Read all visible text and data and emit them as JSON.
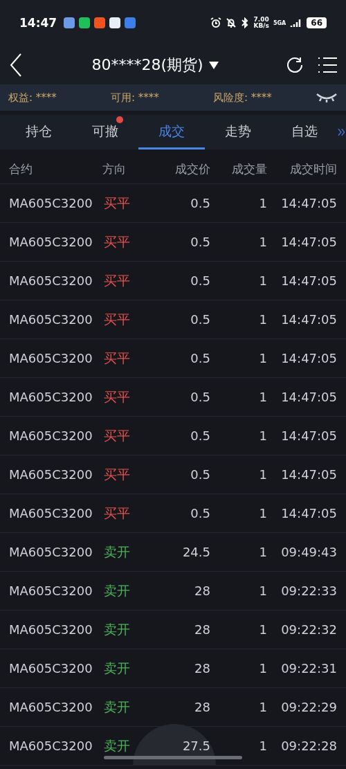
{
  "status_bar": {
    "time": "14:47",
    "speed_value": "7.00",
    "speed_unit": "KB/s",
    "network": "5GA",
    "battery": "66"
  },
  "header": {
    "account": "80****28(期货)"
  },
  "summary": [
    {
      "label": "权益:",
      "value": "****"
    },
    {
      "label": "可用:",
      "value": "****"
    },
    {
      "label": "风险度:",
      "value": "****"
    }
  ],
  "tabs": [
    {
      "label": "持仓",
      "selected": false,
      "badge": false
    },
    {
      "label": "可撤",
      "selected": false,
      "badge": true
    },
    {
      "label": "成交",
      "selected": true,
      "badge": false
    },
    {
      "label": "走势",
      "selected": false,
      "badge": false
    },
    {
      "label": "自选",
      "selected": false,
      "badge": false
    }
  ],
  "table": {
    "columns": [
      "合约",
      "方向",
      "成交价",
      "成交量",
      "成交时间"
    ],
    "rows": [
      {
        "contract": "MA605C3200",
        "direction": "买平",
        "color": "#e5524f",
        "price": "0.5",
        "qty": "1",
        "time": "14:47:05"
      },
      {
        "contract": "MA605C3200",
        "direction": "买平",
        "color": "#e5524f",
        "price": "0.5",
        "qty": "1",
        "time": "14:47:05"
      },
      {
        "contract": "MA605C3200",
        "direction": "买平",
        "color": "#e5524f",
        "price": "0.5",
        "qty": "1",
        "time": "14:47:05"
      },
      {
        "contract": "MA605C3200",
        "direction": "买平",
        "color": "#e5524f",
        "price": "0.5",
        "qty": "1",
        "time": "14:47:05"
      },
      {
        "contract": "MA605C3200",
        "direction": "买平",
        "color": "#e5524f",
        "price": "0.5",
        "qty": "1",
        "time": "14:47:05"
      },
      {
        "contract": "MA605C3200",
        "direction": "买平",
        "color": "#e5524f",
        "price": "0.5",
        "qty": "1",
        "time": "14:47:05"
      },
      {
        "contract": "MA605C3200",
        "direction": "买平",
        "color": "#e5524f",
        "price": "0.5",
        "qty": "1",
        "time": "14:47:05"
      },
      {
        "contract": "MA605C3200",
        "direction": "买平",
        "color": "#e5524f",
        "price": "0.5",
        "qty": "1",
        "time": "14:47:05"
      },
      {
        "contract": "MA605C3200",
        "direction": "买平",
        "color": "#e5524f",
        "price": "0.5",
        "qty": "1",
        "time": "14:47:05"
      },
      {
        "contract": "MA605C3200",
        "direction": "卖开",
        "color": "#4caf5a",
        "price": "24.5",
        "qty": "1",
        "time": "09:49:43"
      },
      {
        "contract": "MA605C3200",
        "direction": "卖开",
        "color": "#4caf5a",
        "price": "28",
        "qty": "1",
        "time": "09:22:33"
      },
      {
        "contract": "MA605C3200",
        "direction": "卖开",
        "color": "#4caf5a",
        "price": "28",
        "qty": "1",
        "time": "09:22:32"
      },
      {
        "contract": "MA605C3200",
        "direction": "卖开",
        "color": "#4caf5a",
        "price": "28",
        "qty": "1",
        "time": "09:22:31"
      },
      {
        "contract": "MA605C3200",
        "direction": "卖开",
        "color": "#4caf5a",
        "price": "28",
        "qty": "1",
        "time": "09:22:29"
      },
      {
        "contract": "MA605C3200",
        "direction": "卖开",
        "color": "#4caf5a",
        "price": "27.5",
        "qty": "1",
        "time": "09:22:28"
      }
    ]
  }
}
